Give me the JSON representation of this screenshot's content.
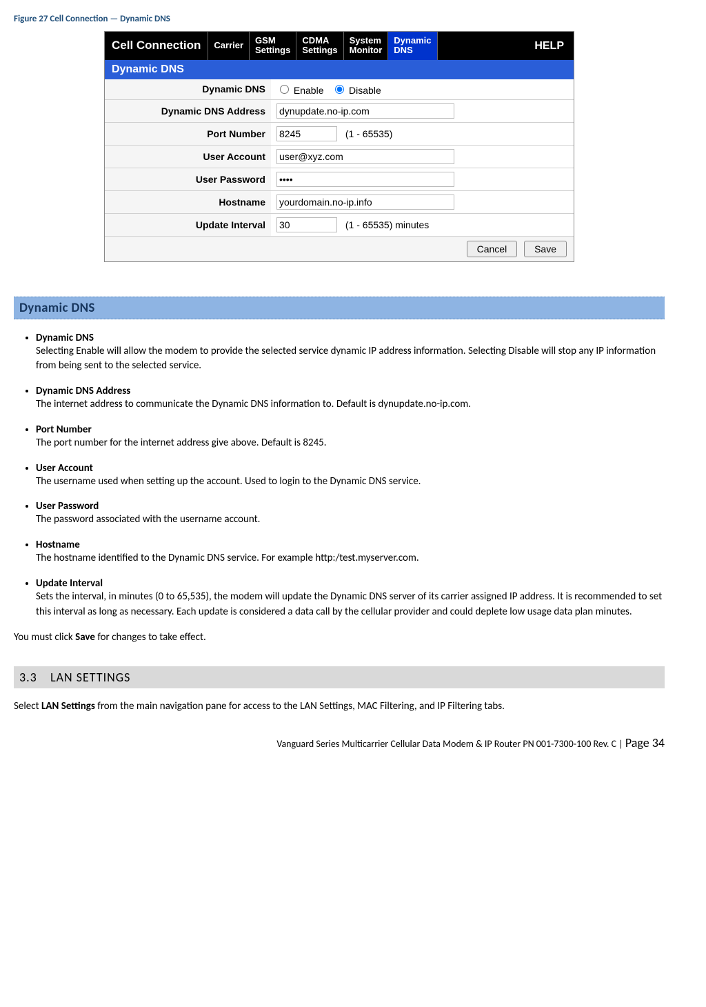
{
  "figure_caption": "Figure 27 Cell Connection — Dynamic DNS",
  "tabs": {
    "main": "Cell Connection",
    "carrier": "Carrier",
    "gsm": "GSM\nSettings",
    "cdma": "CDMA\nSettings",
    "system": "System\nMonitor",
    "dynamic": "Dynamic\nDNS",
    "help": "HELP"
  },
  "panel_title": "Dynamic DNS",
  "form": {
    "dyndns_label": "Dynamic DNS",
    "enable": "Enable",
    "disable": "Disable",
    "address_label": "Dynamic DNS Address",
    "address_value": "dynupdate.no-ip.com",
    "port_label": "Port Number",
    "port_value": "8245",
    "port_hint": "(1 - 65535)",
    "user_label": "User Account",
    "user_value": "user@xyz.com",
    "pass_label": "User Password",
    "pass_value": "••••",
    "host_label": "Hostname",
    "host_value": "yourdomain.no-ip.info",
    "interval_label": "Update Interval",
    "interval_value": "30",
    "interval_hint": "(1 - 65535) minutes",
    "cancel": "Cancel",
    "save": "Save"
  },
  "section_title": "Dynamic DNS",
  "definitions": [
    {
      "term": "Dynamic DNS",
      "desc": "Selecting Enable will allow the modem to provide the selected service dynamic IP address information. Selecting Disable will stop any IP information from being sent to the selected service."
    },
    {
      "term": "Dynamic DNS Address",
      "desc": "The internet address to communicate the Dynamic DNS information to. Default is dynupdate.no-ip.com."
    },
    {
      "term": "Port Number",
      "desc": "The port number for the internet address give above. Default is 8245."
    },
    {
      "term": "User Account",
      "desc": "The username used when setting up the account. Used to login to the Dynamic DNS service."
    },
    {
      "term": "User Password",
      "desc": "The password associated with the username account."
    },
    {
      "term": "Hostname",
      "desc": "The hostname identified to the Dynamic DNS service. For example http:/test.myserver.com."
    },
    {
      "term": "Update Interval",
      "desc": "Sets the interval, in minutes (0 to 65,535), the modem will update the Dynamic DNS server of its carrier assigned IP address. It is recommended to set this interval as long as necessary. Each update is considered a data call by the cellular provider and could deplete low usage data plan minutes."
    }
  ],
  "save_note_pre": "You must click ",
  "save_note_bold": "Save",
  "save_note_post": " for changes to take effect.",
  "heading_num": "3.3",
  "heading_text": "LAN SETTINGS",
  "lan_text_pre": "Select ",
  "lan_text_bold": "LAN Settings",
  "lan_text_post": " from the main navigation pane for access to the LAN Settings, MAC Filtering, and IP Filtering tabs.",
  "footer_product": "Vanguard Series Multicarrier Cellular Data Modem & IP Router PN 001-7300-100 Rev. C",
  "footer_sep": " | ",
  "footer_page": "Page 34"
}
